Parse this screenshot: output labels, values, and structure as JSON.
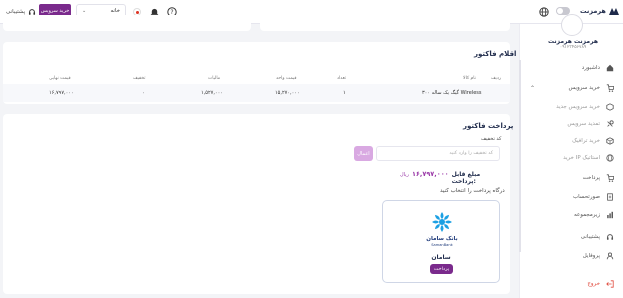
{
  "topbar": {
    "support_label": "پشتیبانی",
    "buy_service_label": "خرید سرویس",
    "home_select_value": "خانه",
    "brand_name": "هرمزنت"
  },
  "user": {
    "name": "هرمزنت هرمزنت",
    "phone": "۰۹۱۲۳۴۵۶۷۸۹"
  },
  "sidebar": {
    "items": [
      {
        "label": "داشبورد",
        "icon": "dashboard-icon"
      },
      {
        "label": "خرید سرویس",
        "icon": "cart-icon"
      },
      {
        "label": "خرید سرویس جدید",
        "icon": "box-icon"
      },
      {
        "label": "تمدید سرویس",
        "icon": "renew-icon"
      },
      {
        "label": "خرید ترافیک",
        "icon": "traffic-icon"
      },
      {
        "label": "خرید IP استاتیک",
        "icon": "globe-icon"
      },
      {
        "label": "پرداخت",
        "icon": "payment-icon"
      },
      {
        "label": "صورتحساب",
        "icon": "invoice-icon"
      },
      {
        "label": "زیرمجموعه",
        "icon": "chart-icon"
      },
      {
        "label": "پشتیبانی",
        "icon": "headset-icon"
      },
      {
        "label": "پروفایل",
        "icon": "user-icon"
      },
      {
        "label": "خروج",
        "icon": "logout-icon"
      }
    ]
  },
  "invoice_items": {
    "title": "اقلام فاکتور",
    "headers": [
      "ردیف",
      "نام کالا",
      "تعداد",
      "قیمت واحد",
      "مالیات",
      "تخفیف",
      "قیمت نهایی"
    ],
    "rows": [
      [
        "",
        "۳۰۰ گیگ یک ساله Wireless",
        "۱",
        "۱۵,۲۷۰,۰۰۰",
        "۱,۵۲۷,۰۰۰",
        "۰",
        "۱۶,۷۹۷,۰۰۰"
      ]
    ]
  },
  "payment": {
    "title": "پرداخت فاکتور",
    "discount_label": "کد تخفیف",
    "discount_placeholder": "کد تخفیف را وارد کنید",
    "apply_label": "اعمال",
    "amount_label": "مبلغ قابل پرداخت:",
    "amount_value": "۱۶,۷۹۷,۰۰۰",
    "amount_unit": "ریال",
    "gateway_prompt": "درگاه پرداخت را انتخاب کنید",
    "gateway_name": "سامان",
    "gateway_logo_text": "بانک سامان",
    "gateway_logo_subtext": "SamanBank",
    "pay_label": "پرداخت"
  },
  "colors": {
    "accent": "#7a2a8c",
    "accent_light": "#d9a9e2",
    "danger": "#e0483b",
    "navy": "#1e2a4a"
  }
}
